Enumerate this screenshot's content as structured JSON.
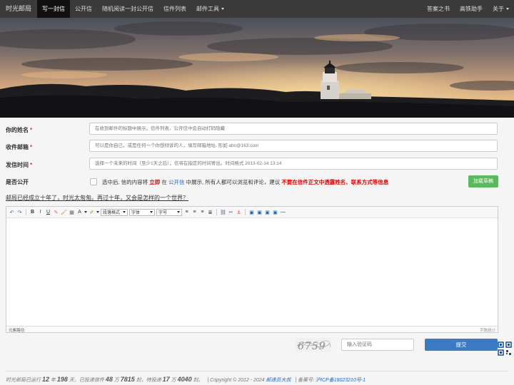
{
  "navbar": {
    "brand": "时光邮局",
    "items": [
      {
        "label": "写一封信",
        "active": true
      },
      {
        "label": "公开信"
      },
      {
        "label": "随机阅读一封公开信"
      },
      {
        "label": "信件列表"
      },
      {
        "label": "邮件工具"
      }
    ],
    "right_items": [
      {
        "label": "答案之书"
      },
      {
        "label": "高铁助手"
      },
      {
        "label": "关于"
      }
    ]
  },
  "form": {
    "name_label": "你的姓名",
    "name_placeholder": "在收到邮件的标题中展示，信件列表、公开信中会自动打码隐藏",
    "email_label": "收件邮箱",
    "email_placeholder": "可以是你自己，或是任何一个你想倾诉的人，填写邮箱地址, 形如 abc@163.com",
    "time_label": "发信时间",
    "time_placeholder": "选择一个未来的时间（至少1天之后），信将在指定的时间寄出。时间格式 2013-02-14 13:14",
    "required_mark": "*",
    "public_label": "是否公开",
    "public_desc_1": "选中后, 信的内容将",
    "public_desc_immediately": "立即",
    "public_desc_2": "在",
    "public_desc_link": "公开信",
    "public_desc_3": "中展示, 所有人都可以浏览和评论，建议",
    "public_desc_warning": "不要在信件正文中透露姓名、联系方式等信息",
    "draft_button": "加载草稿",
    "intro_text": "邮局已经成立十年了，时光太匆匆。再过十年，又会是怎样的一个世界？"
  },
  "editor": {
    "paragraph_format": "段落格式",
    "font_family": "字体",
    "font_size": "字号",
    "status_path_label": "元素路径:",
    "word_count_label": "字数统计"
  },
  "captcha": {
    "code_text": "6759",
    "input_placeholder": "输入验证码",
    "submit_label": "提交"
  },
  "footer": {
    "t1": "时光邮局已运行",
    "years": "12",
    "t2": "年",
    "days": "198",
    "t3": "天，已投递信件",
    "sent_wan": "48",
    "t4": "万",
    "sent_rest": "7815",
    "t5": "封，待投递",
    "pending_wan": "17",
    "t6": "万",
    "pending_rest": "4040",
    "t7": "封。",
    "copyright": "|   Copyright © 2012 - 2024",
    "copyright_link": "邮递员大叔",
    "icp_prefix": "|   备案号:",
    "icp_link": "沪ICP备18023210号-1"
  },
  "colors": {
    "navbar_bg": "#3a3a3a",
    "navbar_active": "#111111",
    "draft_button": "#5cb85c",
    "submit_button": "#3a7bc4",
    "warning_red": "#dd0000",
    "link_blue": "#2266bb"
  }
}
